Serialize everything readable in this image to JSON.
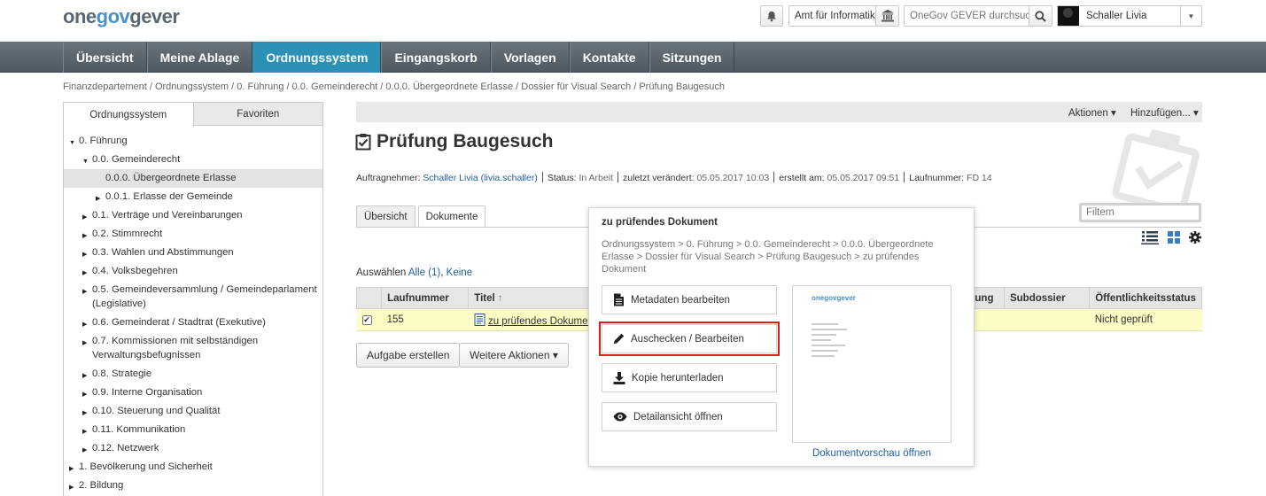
{
  "header": {
    "logo": {
      "one": "one",
      "gov": "gov",
      "gever": "gever"
    },
    "org_label": "Amt für Informatik",
    "search_placeholder": "OneGov GEVER durchsuchen",
    "user_name": "Schaller Livia"
  },
  "nav": {
    "items": [
      {
        "label": "Übersicht",
        "active": false
      },
      {
        "label": "Meine Ablage",
        "active": false
      },
      {
        "label": "Ordnungssystem",
        "active": true
      },
      {
        "label": "Eingangskorb",
        "active": false
      },
      {
        "label": "Vorlagen",
        "active": false
      },
      {
        "label": "Kontakte",
        "active": false
      },
      {
        "label": "Sitzungen",
        "active": false
      }
    ]
  },
  "breadcrumb": "Finanzdepartement / Ordnungssystem / 0. Führung / 0.0. Gemeinderecht / 0.0.0. Übergeordnete Erlasse / Dossier für Visual Search / Prüfung Baugesuch",
  "sidebar": {
    "tabs": [
      "Ordnungssystem",
      "Favoriten"
    ],
    "tree": [
      {
        "label": "0. Führung",
        "level": 0,
        "expanded": true
      },
      {
        "label": "0.0. Gemeinderecht",
        "level": 1,
        "expanded": true
      },
      {
        "label": "0.0.0. Übergeordnete Erlasse",
        "level": 2,
        "selected": true,
        "leaf": true
      },
      {
        "label": "0.0.1. Erlasse der Gemeinde",
        "level": 2
      },
      {
        "label": "0.1. Verträge und Vereinbarungen",
        "level": 1
      },
      {
        "label": "0.2. Stimmrecht",
        "level": 1
      },
      {
        "label": "0.3. Wahlen und Abstimmungen",
        "level": 1
      },
      {
        "label": "0.4. Volksbegehren",
        "level": 1
      },
      {
        "label": "0.5. Gemeindeversammlung / Gemeindeparlament (Legislative)",
        "level": 1
      },
      {
        "label": "0.6. Gemeinderat / Stadtrat (Exekutive)",
        "level": 1
      },
      {
        "label": "0.7. Kommissionen mit selbständigen Verwaltungsbefugnissen",
        "level": 1
      },
      {
        "label": "0.8. Strategie",
        "level": 1
      },
      {
        "label": "0.9. Interne Organisation",
        "level": 1
      },
      {
        "label": "0.10. Steuerung und Qualität",
        "level": 1
      },
      {
        "label": "0.11. Kommunikation",
        "level": 1
      },
      {
        "label": "0.12. Netzwerk",
        "level": 1
      },
      {
        "label": "1. Bevölkerung und Sicherheit",
        "level": 0
      },
      {
        "label": "2. Bildung",
        "level": 0
      }
    ]
  },
  "actions": {
    "aktionen": "Aktionen ▾",
    "hinzufuegen": "Hinzufügen... ▾"
  },
  "page_title": "Prüfung Baugesuch",
  "meta": {
    "auftragnehmer_label": "Auftragnehmer:",
    "auftragnehmer_value": "Schaller Livia (livia.schaller)",
    "status_label": "Status:",
    "status_value": "In Arbeit",
    "changed_label": "zuletzt verändert:",
    "changed_value": "05.05.2017 10:03",
    "created_label": "erstellt am:",
    "created_value": "05.05.2017 09:51",
    "nr_label": "Laufnummer:",
    "nr_value": "FD 14"
  },
  "content_tabs": [
    "Übersicht",
    "Dokumente"
  ],
  "filter_placeholder": "Filtern",
  "selection": {
    "prefix": "Auswählen",
    "all": "Alle (1)",
    "sep": ",",
    "none": "Keine"
  },
  "table": {
    "headers": [
      "",
      "Laufnummer",
      "Titel",
      "In Bearbeitung",
      "Subdossier",
      "Öffentlichkeitsstatus"
    ],
    "row": {
      "nr": "155",
      "title": "zu prüfendes Dokument",
      "bearbeitung": "",
      "subdossier": "",
      "oeffentlich": "Nicht geprüft"
    },
    "sort_icon": "↑"
  },
  "buttons": {
    "create_task": "Aufgabe erstellen",
    "more_actions": "Weitere Aktionen ▾"
  },
  "popover": {
    "title": "zu prüfendes Dokument",
    "path": "Ordnungssystem  >  0. Führung  >  0.0. Gemeinderecht  >  0.0.0. Übergeordnete Erlasse  >  Dossier für Visual Search  >  Prüfung Baugesuch  >  zu prüfendes Dokument",
    "actions": [
      "Metadaten bearbeiten",
      "Auschecken / Bearbeiten",
      "Kopie herunterladen",
      "Detailansicht öffnen"
    ],
    "preview_link": "Dokumentvorschau öffnen",
    "highlight_color": "#e0191c"
  },
  "colors": {
    "nav_active": "#2b91b7",
    "row_highlight": "#fcfcc5",
    "link": "#1f5fa6"
  }
}
